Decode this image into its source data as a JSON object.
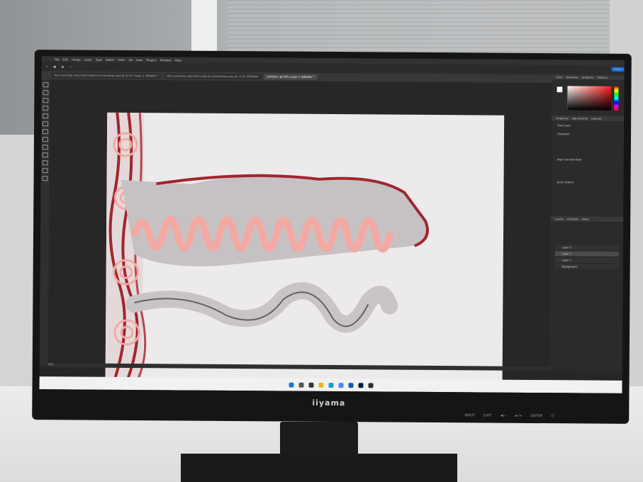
{
  "app": {
    "menu": [
      "File",
      "Edit",
      "Image",
      "Layer",
      "Type",
      "Select",
      "Filter",
      "3D",
      "View",
      "Plugins",
      "Window",
      "Help"
    ],
    "share_label": "Share",
    "tabs": [
      "this is pending untouched ready for printmaking copy @ 12.5% (Layer 1, RGB/8#) *",
      "this is pending untouched ready for printmaking copy @ 12.5% (RGB/8#)",
      "Untitled-1 @ 50% (Layer 1, RGB/8#) *"
    ],
    "status_zoom": "50%",
    "panels": {
      "color_tabs": [
        "Color",
        "Swatches",
        "Gradients",
        "Patterns"
      ],
      "props_tabs": [
        "Properties",
        "Adjustments",
        "Libraries"
      ],
      "props_items": [
        "Pixel Layer",
        "Transform",
        "Align and Distribute",
        "Quick Actions"
      ],
      "layer_tabs": [
        "Layers",
        "Channels",
        "Paths"
      ],
      "layers": [
        "Layer 3",
        "Layer 2",
        "Layer 1",
        "Background"
      ]
    }
  },
  "monitor": {
    "brand": "iiyama",
    "buttons": [
      "INPUT",
      "EXIT",
      "◄/−",
      "►/+",
      "ENTER",
      "⏻"
    ]
  },
  "colors": {
    "canvas": "#eceaeb",
    "accent_red": "#a1252f",
    "accent_pink": "#f3a9a3"
  }
}
